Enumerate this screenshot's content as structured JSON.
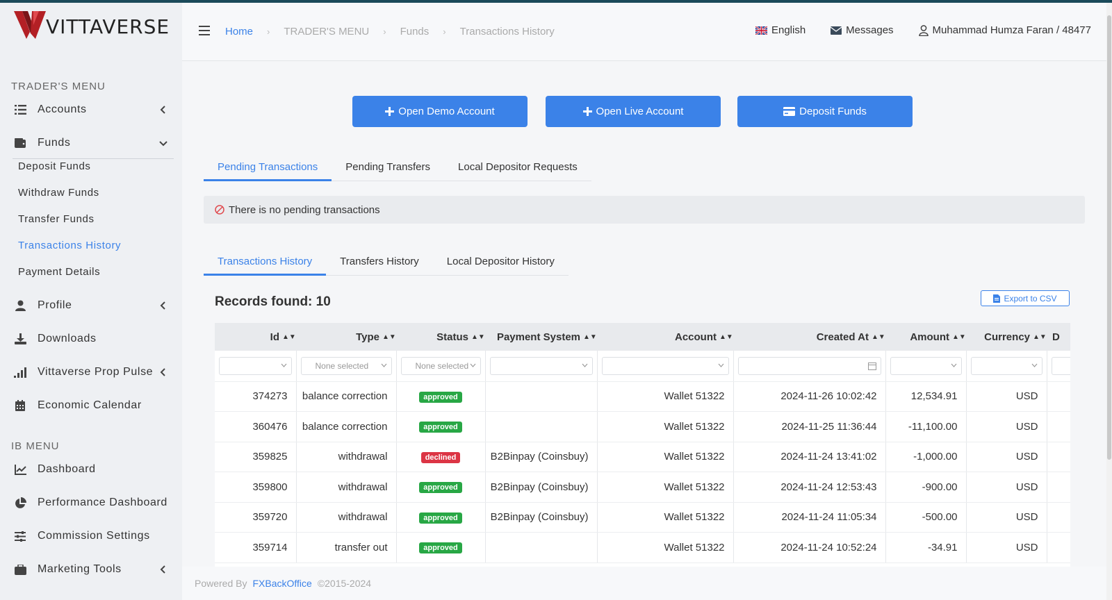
{
  "brand": {
    "name": "VITTAVERSE",
    "accent": "#3b82e8",
    "logo_color": "#b32025"
  },
  "sidebar": {
    "traders_menu_label": "TRADER'S MENU",
    "ib_menu_label": "IB MENU",
    "items": {
      "accounts": "Accounts",
      "funds": "Funds",
      "profile": "Profile",
      "downloads": "Downloads",
      "prop_pulse": "Vittaverse Prop Pulse",
      "economic_calendar": "Economic Calendar",
      "dashboard": "Dashboard",
      "performance_dashboard": "Performance Dashboard",
      "commission_settings": "Commission Settings",
      "marketing_tools": "Marketing Tools"
    },
    "funds_sub": {
      "deposit": "Deposit Funds",
      "withdraw": "Withdraw Funds",
      "transfer": "Transfer Funds",
      "history": "Transactions History",
      "payment": "Payment Details"
    }
  },
  "header": {
    "breadcrumb": [
      "Home",
      "TRADER'S MENU",
      "Funds",
      "Transactions History"
    ],
    "language": "English",
    "messages": "Messages",
    "user": "Muhammad Humza Faran / 48477"
  },
  "actions": {
    "open_demo": "Open Demo Account",
    "open_live": "Open Live Account",
    "deposit": "Deposit Funds"
  },
  "pending_tabs": [
    "Pending Transactions",
    "Pending Transfers",
    "Local Depositor Requests"
  ],
  "pending_alert": "There is no pending transactions",
  "history_tabs": [
    "Transactions History",
    "Transfers History",
    "Local Depositor History"
  ],
  "records_found": "Records found: 10",
  "export_label": "Export to CSV",
  "table": {
    "columns": [
      "Id",
      "Type",
      "Status",
      "Payment System",
      "Account",
      "Created At",
      "Amount",
      "Currency"
    ],
    "filter_placeholders": {
      "type": "None selected",
      "status": "None selected"
    },
    "rows": [
      {
        "id": "374273",
        "type": "balance correction",
        "status": "approved",
        "payment": "",
        "account": "Wallet 51322",
        "created": "2024-11-26 10:02:42",
        "amount": "12,534.91",
        "currency": "USD"
      },
      {
        "id": "360476",
        "type": "balance correction",
        "status": "approved",
        "payment": "",
        "account": "Wallet 51322",
        "created": "2024-11-25 11:36:44",
        "amount": "-11,100.00",
        "currency": "USD"
      },
      {
        "id": "359825",
        "type": "withdrawal",
        "status": "declined",
        "payment": "B2Binpay (Coinsbuy)",
        "account": "Wallet 51322",
        "created": "2024-11-24 13:41:02",
        "amount": "-1,000.00",
        "currency": "USD"
      },
      {
        "id": "359800",
        "type": "withdrawal",
        "status": "approved",
        "payment": "B2Binpay (Coinsbuy)",
        "account": "Wallet 51322",
        "created": "2024-11-24 12:53:43",
        "amount": "-900.00",
        "currency": "USD"
      },
      {
        "id": "359720",
        "type": "withdrawal",
        "status": "approved",
        "payment": "B2Binpay (Coinsbuy)",
        "account": "Wallet 51322",
        "created": "2024-11-24 11:05:34",
        "amount": "-500.00",
        "currency": "USD"
      },
      {
        "id": "359714",
        "type": "transfer out",
        "status": "approved",
        "payment": "",
        "account": "Wallet 51322",
        "created": "2024-11-24 10:52:24",
        "amount": "-34.91",
        "currency": "USD"
      }
    ]
  },
  "footer": {
    "powered_by": "Powered By",
    "brand": "FXBackOffice",
    "years": "©2015-2024"
  }
}
